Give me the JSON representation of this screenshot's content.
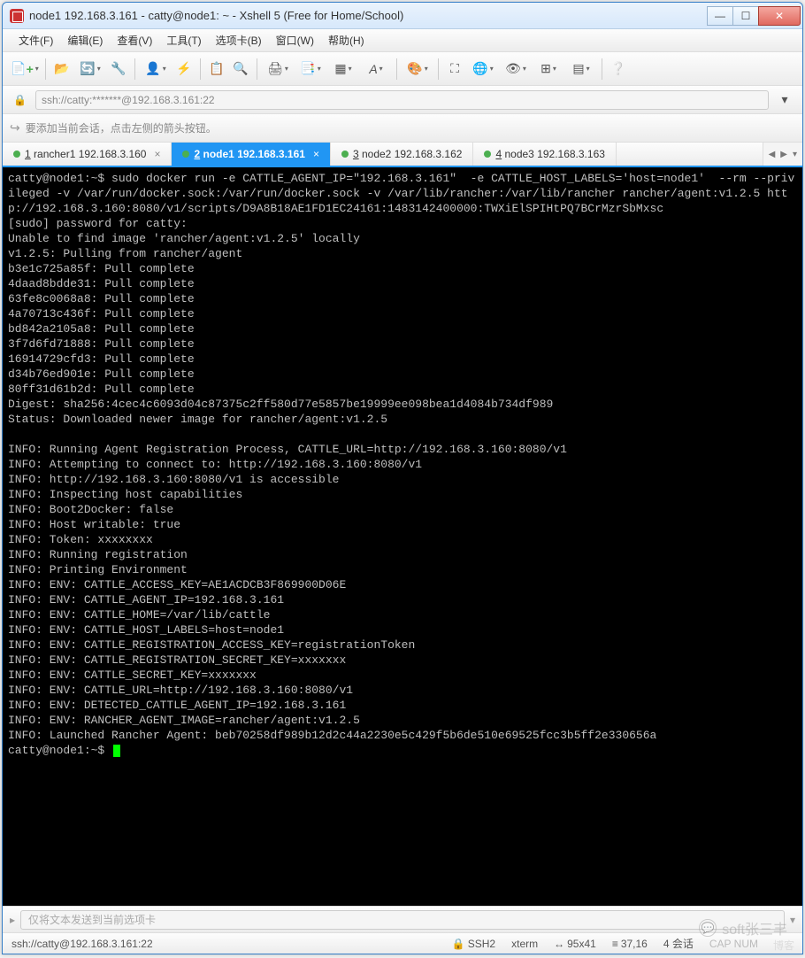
{
  "window": {
    "title": "node1 192.168.3.161 - catty@node1: ~ - Xshell 5 (Free for Home/School)"
  },
  "menu": {
    "items": [
      "文件(F)",
      "编辑(E)",
      "查看(V)",
      "工具(T)",
      "选项卡(B)",
      "窗口(W)",
      "帮助(H)"
    ]
  },
  "addressbar": {
    "text": "ssh://catty:*******@192.168.3.161:22"
  },
  "tip": {
    "text": "要添加当前会话，点击左侧的箭头按钮。"
  },
  "tabs": {
    "items": [
      {
        "num": "1",
        "label": "rancher1 192.168.3.160",
        "active": false,
        "close": true
      },
      {
        "num": "2",
        "label": "node1 192.168.3.161",
        "active": true,
        "close": true
      },
      {
        "num": "3",
        "label": "node2 192.168.3.162",
        "active": false,
        "close": false
      },
      {
        "num": "4",
        "label": "node3 192.168.3.163",
        "active": false,
        "close": false
      }
    ]
  },
  "terminal": {
    "content": "catty@node1:~$ sudo docker run -e CATTLE_AGENT_IP=\"192.168.3.161\"  -e CATTLE_HOST_LABELS='host=node1'  --rm --privileged -v /var/run/docker.sock:/var/run/docker.sock -v /var/lib/rancher:/var/lib/rancher rancher/agent:v1.2.5 http://192.168.3.160:8080/v1/scripts/D9A8B18AE1FD1EC24161:1483142400000:TWXiElSPIHtPQ7BCrMzrSbMxsc\n[sudo] password for catty:\nUnable to find image 'rancher/agent:v1.2.5' locally\nv1.2.5: Pulling from rancher/agent\nb3e1c725a85f: Pull complete\n4daad8bdde31: Pull complete\n63fe8c0068a8: Pull complete\n4a70713c436f: Pull complete\nbd842a2105a8: Pull complete\n3f7d6fd71888: Pull complete\n16914729cfd3: Pull complete\nd34b76ed901e: Pull complete\n80ff31d61b2d: Pull complete\nDigest: sha256:4cec4c6093d04c87375c2ff580d77e5857be19999ee098bea1d4084b734df989\nStatus: Downloaded newer image for rancher/agent:v1.2.5\n\nINFO: Running Agent Registration Process, CATTLE_URL=http://192.168.3.160:8080/v1\nINFO: Attempting to connect to: http://192.168.3.160:8080/v1\nINFO: http://192.168.3.160:8080/v1 is accessible\nINFO: Inspecting host capabilities\nINFO: Boot2Docker: false\nINFO: Host writable: true\nINFO: Token: xxxxxxxx\nINFO: Running registration\nINFO: Printing Environment\nINFO: ENV: CATTLE_ACCESS_KEY=AE1ACDCB3F869900D06E\nINFO: ENV: CATTLE_AGENT_IP=192.168.3.161\nINFO: ENV: CATTLE_HOME=/var/lib/cattle\nINFO: ENV: CATTLE_HOST_LABELS=host=node1\nINFO: ENV: CATTLE_REGISTRATION_ACCESS_KEY=registrationToken\nINFO: ENV: CATTLE_REGISTRATION_SECRET_KEY=xxxxxxx\nINFO: ENV: CATTLE_SECRET_KEY=xxxxxxx\nINFO: ENV: CATTLE_URL=http://192.168.3.160:8080/v1\nINFO: ENV: DETECTED_CATTLE_AGENT_IP=192.168.3.161\nINFO: ENV: RANCHER_AGENT_IMAGE=rancher/agent:v1.2.5\nINFO: Launched Rancher Agent: beb70258df989b12d2c44a2230e5c429f5b6de510e69525fcc3b5ff2e330656a",
    "prompt": "catty@node1:~$ "
  },
  "bottombar": {
    "placeholder": "仅将文本发送到当前选项卡"
  },
  "statusbar": {
    "conn": "ssh://catty@192.168.3.161:22",
    "proto": "SSH2",
    "term": "xterm",
    "size": "95x41",
    "pos": "37,16",
    "sessions": "4 会话",
    "caps": "CAP  NUM"
  },
  "watermark": {
    "text": "soft张三丰",
    "sub": "博客"
  }
}
